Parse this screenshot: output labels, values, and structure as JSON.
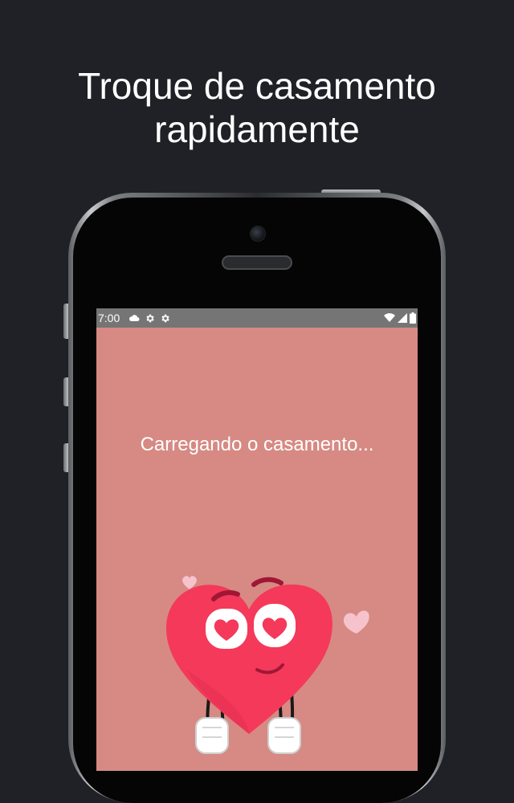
{
  "headline": {
    "line1": "Troque de casamento",
    "line2": "rapidamente"
  },
  "status_bar": {
    "time": "7:00",
    "left_icons": [
      "cloud-icon",
      "gear-icon",
      "gear-icon"
    ],
    "right_icons": [
      "wifi-icon",
      "signal-icon",
      "battery-icon"
    ]
  },
  "screen": {
    "loading_text": "Carregando o casamento...",
    "background_color": "#d68a83"
  },
  "colors": {
    "page_background": "#1f2126",
    "heart": "#f4395b",
    "small_heart": "#f6c3cd"
  }
}
